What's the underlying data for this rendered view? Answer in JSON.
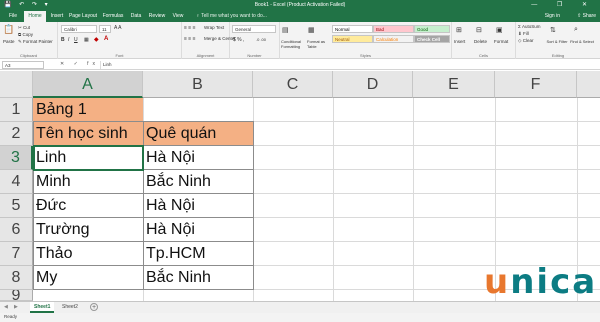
{
  "window": {
    "title": "Book1 - Excel (Product Activation Failed)",
    "controls": [
      "—",
      "❐",
      "✕"
    ],
    "quick_access": [
      "💾",
      "↶",
      "↷",
      "▾"
    ]
  },
  "tabs": [
    "File",
    "Home",
    "Insert",
    "Page Layout",
    "Formulas",
    "Data",
    "Review",
    "View"
  ],
  "active_tab": "Home",
  "tell_me": "Tell me what you want to do...",
  "sign_in": "Sign in",
  "share": "Share",
  "ribbon": {
    "clipboard": {
      "paste": "Paste",
      "cut": "Cut",
      "copy": "Copy",
      "format_painter": "Format Painter",
      "label": "Clipboard"
    },
    "font": {
      "name": "Calibri",
      "size": "11",
      "label": "Font",
      "bold": "B",
      "italic": "I",
      "underline": "U"
    },
    "alignment": {
      "wrap_text": "Wrap Text",
      "merge_center": "Merge & Center",
      "label": "Alignment"
    },
    "number": {
      "format": "General",
      "label": "Number"
    },
    "styles": {
      "conditional_formatting": "Conditional Formatting",
      "format_as_table": "Format as Table",
      "cells": [
        {
          "label": "Normal",
          "bg": "#ffffff",
          "fg": "#000000"
        },
        {
          "label": "Bad",
          "bg": "#ffc7ce",
          "fg": "#9c0006"
        },
        {
          "label": "Good",
          "bg": "#c6efce",
          "fg": "#006100"
        },
        {
          "label": "Neutral",
          "bg": "#ffeb9c",
          "fg": "#9c5700"
        },
        {
          "label": "Calculation",
          "bg": "#f2f2f2",
          "fg": "#fa7d00"
        },
        {
          "label": "Check Cell",
          "bg": "#a5a5a5",
          "fg": "#ffffff"
        }
      ],
      "label": "Styles"
    },
    "cells": {
      "insert": "Insert",
      "delete": "Delete",
      "format": "Format",
      "label": "Cells"
    },
    "editing": {
      "autosum": "AutoSum",
      "fill": "Fill",
      "clear": "Clear",
      "sort_filter": "Sort & Filter",
      "find_select": "Find & Select",
      "label": "Editing"
    }
  },
  "formula_bar": {
    "name_box": "A3",
    "icons": "✕ ✓ fx",
    "content": "Linh"
  },
  "grid": {
    "columns": [
      "A",
      "B",
      "C",
      "D",
      "E",
      "F"
    ],
    "rows": [
      "1",
      "2",
      "3",
      "4",
      "5",
      "6",
      "7",
      "8",
      "9"
    ],
    "selected_column": "A",
    "selected_row": "3",
    "cells": {
      "A1": "Bảng 1",
      "A2": "Tên học sinh",
      "B2": "Quê quán",
      "A3": "Linh",
      "B3": "Hà Nội",
      "A4": "Minh",
      "B4": "Bắc Ninh",
      "A5": "Đức",
      "B5": "Hà Nội",
      "A6": "Trường",
      "B6": "Hà Nội",
      "A7": "Thảo",
      "B7": "Tp.HCM",
      "A8": "My",
      "B8": "Bắc Ninh"
    },
    "header_fill": "#f4b084"
  },
  "sheets": [
    "Sheet1",
    "Sheet2"
  ],
  "active_sheet": "Sheet1",
  "status": "Ready",
  "watermark": {
    "first": "u",
    "rest": "nica"
  }
}
